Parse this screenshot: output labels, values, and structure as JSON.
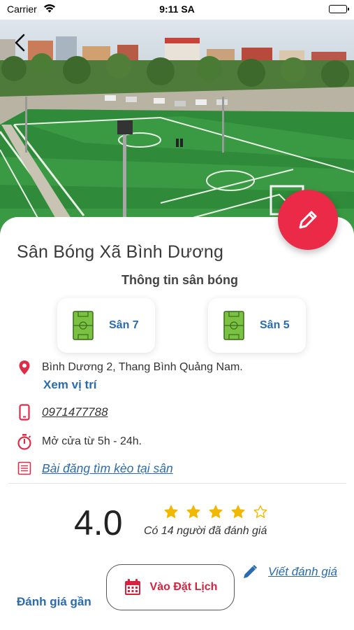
{
  "status_bar": {
    "carrier": "Carrier",
    "time": "9:11 SA"
  },
  "venue": {
    "name": "Sân Bóng Xã Bình Dương",
    "section_title": "Thông tin sân bóng",
    "fields": [
      {
        "label": "Sân 7",
        "icon": "soccer-pitch-icon"
      },
      {
        "label": "Sân 5",
        "icon": "soccer-pitch-icon"
      }
    ],
    "address": "Bình Dương 2, Thang Bình Quảng Nam.",
    "view_location": "Xem vị trí",
    "phone": "0971477788",
    "hours": "Mở cửa từ 5h - 24h.",
    "posts_link": "Bài đăng tìm kèo tại sân"
  },
  "rating": {
    "score": "4.0",
    "stars_filled": 4,
    "stars_total": 5,
    "count_text": "Có 14 người đã đánh giá"
  },
  "actions": {
    "write_review": "Viết đánh giá",
    "book": "Vào Đặt Lịch",
    "recent_reviews": "Đánh giá gần"
  },
  "colors": {
    "accent_red": "#ea2a47",
    "link_blue": "#2a6bb0",
    "star_gold": "#f2b705",
    "pitch_green": "#7cc242"
  }
}
